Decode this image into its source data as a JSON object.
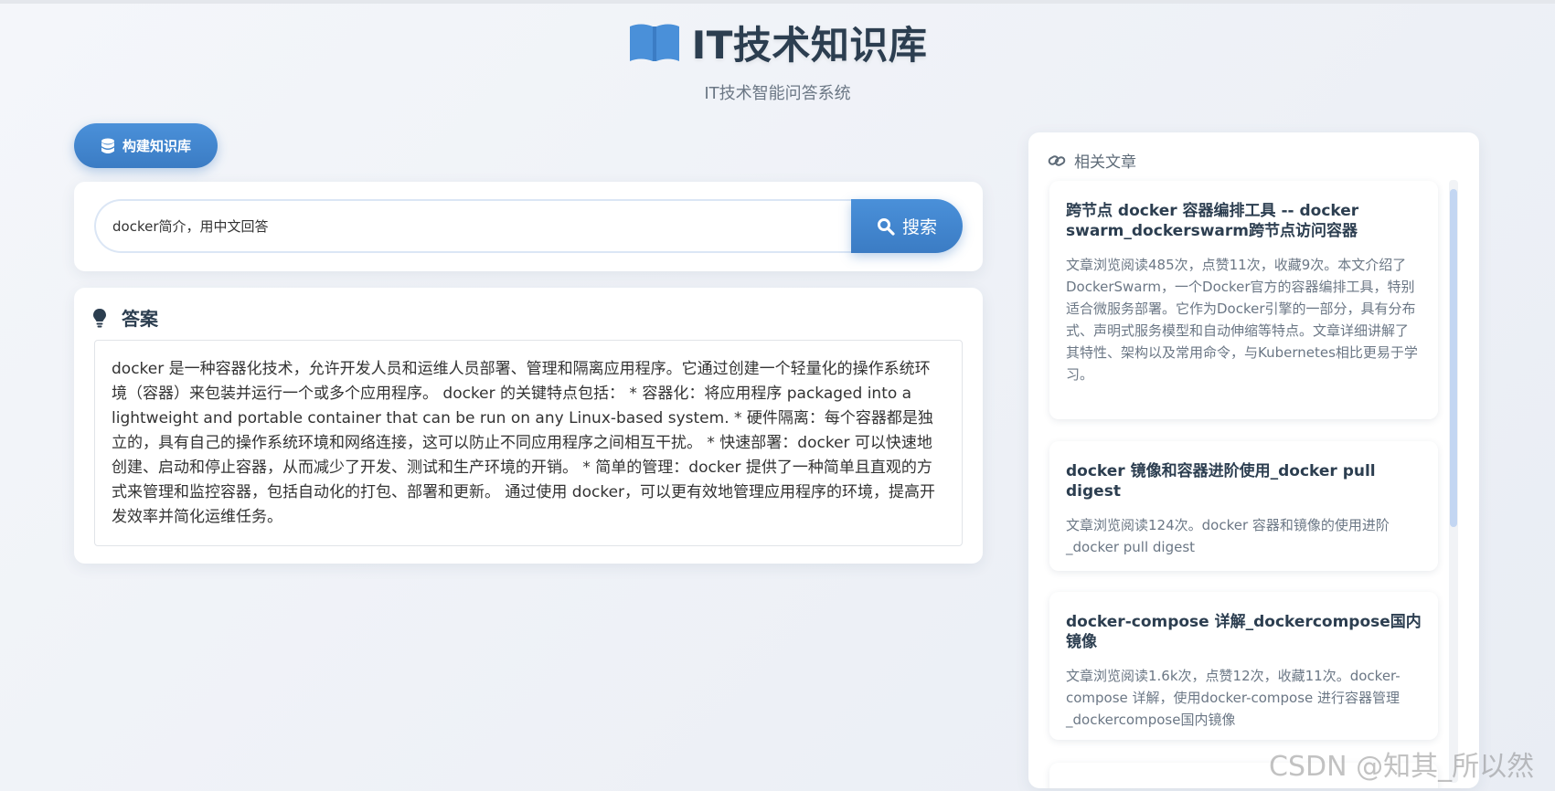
{
  "header": {
    "title": "IT技术知识库",
    "subtitle": "IT技术智能问答系统"
  },
  "build_button": {
    "label": "构建知识库"
  },
  "search": {
    "query": "docker简介，用中文回答",
    "button_label": "搜索"
  },
  "answer": {
    "title": "答案",
    "text": "docker 是一种容器化技术，允许开发人员和运维人员部署、管理和隔离应用程序。它通过创建一个轻量化的操作系统环境（容器）来包装并运行一个或多个应用程序。 docker 的关键特点包括： * 容器化：将应用程序 packaged into a lightweight and portable container that can be run on any Linux-based system. * 硬件隔离：每个容器都是独立的，具有自己的操作系统环境和网络连接，这可以防止不同应用程序之间相互干扰。 * 快速部署：docker 可以快速地创建、启动和停止容器，从而减少了开发、测试和生产环境的开销。 * 简单的管理：docker 提供了一种简单且直观的方式来管理和监控容器，包括自动化的打包、部署和更新。 通过使用 docker，可以更有效地管理应用程序的环境，提高开发效率并简化运维任务。"
  },
  "related": {
    "title": "相关文章",
    "articles": [
      {
        "title": "跨节点 docker 容器编排工具 -- docker swarm_dockerswarm跨节点访问容器",
        "desc": "文章浏览阅读485次，点赞11次，收藏9次。本文介绍了DockerSwarm，一个Docker官方的容器编排工具，特别适合微服务部署。它作为Docker引擎的一部分，具有分布式、声明式服务模型和自动伸缩等特点。文章详细讲解了其特性、架构以及常用命令，与Kubernetes相比更易于学习。"
      },
      {
        "title": "docker 镜像和容器进阶使用_docker pull digest",
        "desc": "文章浏览阅读124次。docker 容器和镜像的使用进阶_docker pull digest"
      },
      {
        "title": "docker-compose 详解_dockercompose国内镜像",
        "desc": "文章浏览阅读1.6k次，点赞12次，收藏11次。docker-compose 详解，使用docker-compose 进行容器管理_dockercompose国内镜像"
      }
    ]
  },
  "watermark": "CSDN @知其_所以然",
  "colors": {
    "accent": "#4a90d9",
    "title": "#2c3e50",
    "muted": "#6b7785"
  }
}
